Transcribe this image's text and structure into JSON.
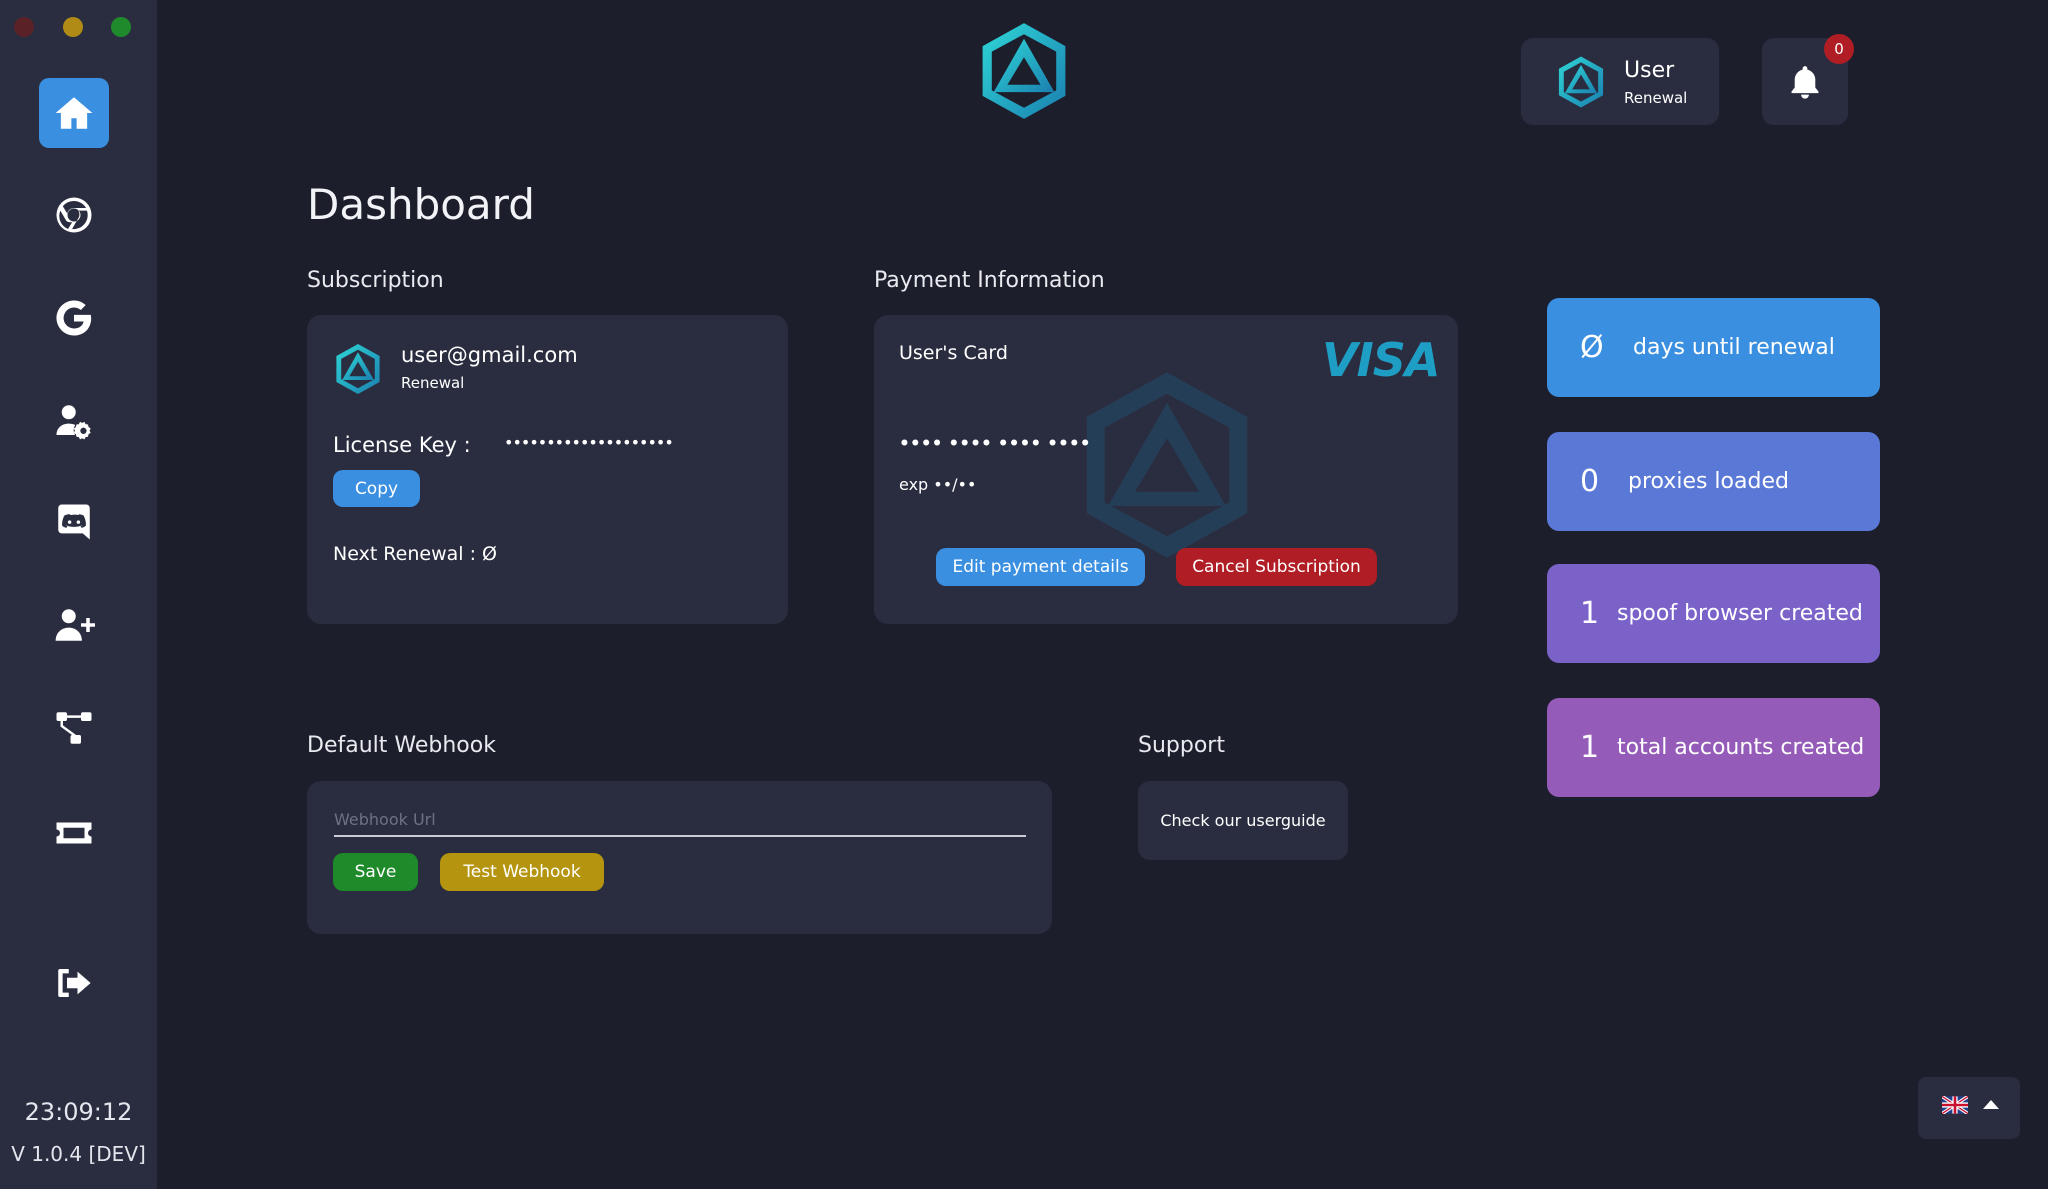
{
  "window": {
    "controls": [
      "close",
      "minimize",
      "maximize"
    ]
  },
  "sidebar": {
    "items": [
      {
        "icon": "home-icon",
        "active": true
      },
      {
        "icon": "chrome-icon",
        "active": false
      },
      {
        "icon": "google-icon",
        "active": false
      },
      {
        "icon": "user-settings-icon",
        "active": false
      },
      {
        "icon": "discord-icon",
        "active": false
      },
      {
        "icon": "add-user-icon",
        "active": false
      },
      {
        "icon": "tree-icon",
        "active": false
      },
      {
        "icon": "ticket-icon",
        "active": false
      },
      {
        "icon": "logout-icon",
        "active": false
      }
    ],
    "clock": "23:09:12",
    "version": "V 1.0.4 [DEV]"
  },
  "header": {
    "user_name": "User",
    "user_plan": "Renewal",
    "notification_count": "0"
  },
  "page_title": "Dashboard",
  "subscription": {
    "title": "Subscription",
    "email": "user@gmail.com",
    "plan": "Renewal",
    "license_label": "License Key :",
    "license_value": "••••••••••••••••••••",
    "copy_label": "Copy",
    "next_renewal": "Next Renewal : Ø"
  },
  "payment": {
    "title": "Payment Information",
    "card_holder": "User's Card",
    "brand": "VISA",
    "card_number": "•••• •••• •••• ••••",
    "expiry": "exp ••/••",
    "edit_label": "Edit payment details",
    "cancel_label": "Cancel Subscription"
  },
  "stats": [
    {
      "value": "Ø",
      "label": "days until renewal",
      "color": "#3a8fe0"
    },
    {
      "value": "0",
      "label": "proxies loaded",
      "color": "#5a78d6"
    },
    {
      "value": "1",
      "label": "spoof browser created",
      "color": "#7a62c9"
    },
    {
      "value": "1",
      "label": "total accounts created",
      "color": "#955bb9"
    }
  ],
  "webhook": {
    "title": "Default Webhook",
    "placeholder": "Webhook Url",
    "value": "",
    "save_label": "Save",
    "test_label": "Test Webhook"
  },
  "support": {
    "title": "Support",
    "button_label": "Check our userguide"
  },
  "language": {
    "flag": "uk-flag-icon"
  },
  "colors": {
    "background": "#1c1e2c",
    "panel": "#2a2d3f",
    "accent_blue": "#3a8fe0",
    "danger": "#b01d24",
    "success": "#1e8a2a",
    "warning": "#b5950f",
    "logo_teal": "#1fb5c9"
  }
}
